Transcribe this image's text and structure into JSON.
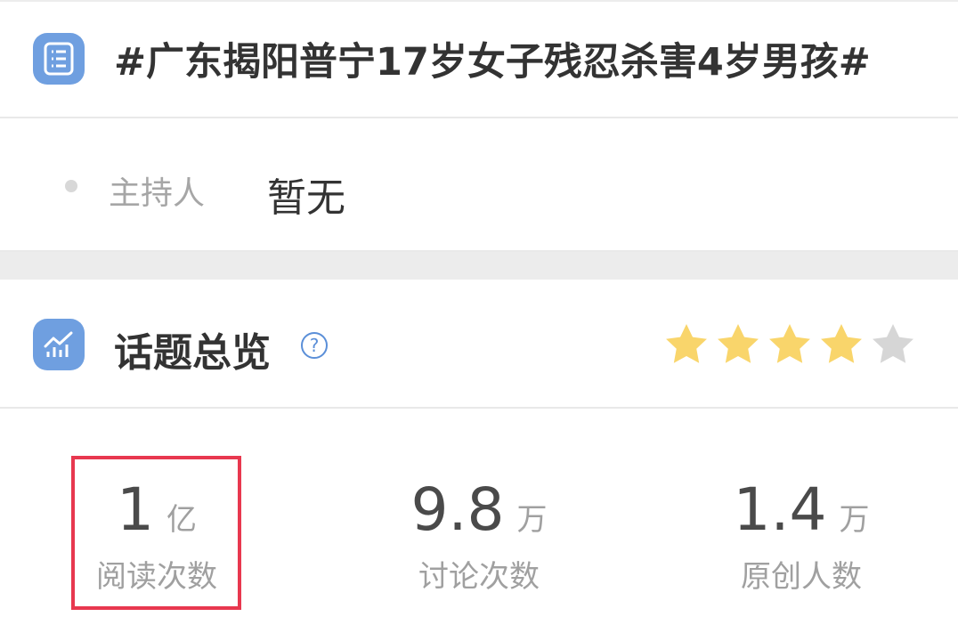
{
  "topic": {
    "title": "#广东揭阳普宁17岁女子残忍杀害4岁男孩#"
  },
  "host": {
    "label": "主持人",
    "value": "暂无"
  },
  "overview": {
    "title": "话题总览",
    "help": "?",
    "rating": 4,
    "rating_max": 5
  },
  "stats": [
    {
      "value": "1",
      "unit": "亿",
      "label": "阅读次数"
    },
    {
      "value": "9.8",
      "unit": "万",
      "label": "讨论次数"
    },
    {
      "value": "1.4",
      "unit": "万",
      "label": "原创人数"
    }
  ],
  "colors": {
    "accent": "#6f9fe0",
    "star_on": "#f9d56b",
    "star_off": "#d6d6d6",
    "highlight": "#e8384f"
  }
}
